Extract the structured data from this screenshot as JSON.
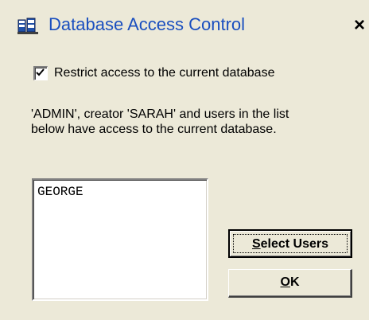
{
  "window": {
    "title": "Database Access Control",
    "close_label": "×"
  },
  "restrict_checkbox": {
    "label": "Restrict access to the current database",
    "checked": true
  },
  "description": {
    "line1": "'ADMIN', creator 'SARAH' and users in the list",
    "line2": "below have access to the current database."
  },
  "users_list": {
    "items": [
      "GEORGE"
    ]
  },
  "buttons": {
    "select_users": {
      "mnemonic": "S",
      "rest": "elect Users"
    },
    "ok": {
      "mnemonic": "O",
      "rest": "K"
    }
  },
  "colors": {
    "title_text": "#1a4fbf",
    "background": "#ece9d8"
  },
  "icons": {
    "title": "database-icon",
    "checkmark": "checkmark-icon"
  }
}
